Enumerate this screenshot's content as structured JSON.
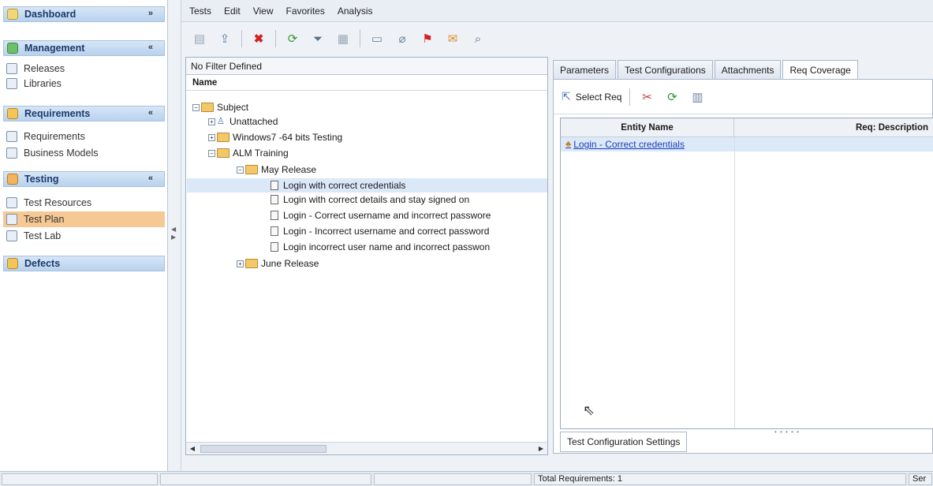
{
  "sidebar": {
    "dashboard": {
      "label": "Dashboard",
      "chevron": "»"
    },
    "management": {
      "label": "Management",
      "chevron": "«"
    },
    "management_items": [
      {
        "label": "Releases"
      },
      {
        "label": "Libraries"
      }
    ],
    "requirements": {
      "label": "Requirements",
      "chevron": "«"
    },
    "requirements_items": [
      {
        "label": "Requirements"
      },
      {
        "label": "Business Models"
      }
    ],
    "testing": {
      "label": "Testing",
      "chevron": "«"
    },
    "testing_items": [
      {
        "label": "Test Resources"
      },
      {
        "label": "Test Plan",
        "active": true
      },
      {
        "label": "Test Lab"
      }
    ],
    "defects": {
      "label": "Defects"
    }
  },
  "menu": [
    "Tests",
    "Edit",
    "View",
    "Favorites",
    "Analysis"
  ],
  "tree": {
    "filter_text": "No Filter Defined",
    "header": "Name",
    "nodes": [
      {
        "label": "Subject"
      },
      {
        "label": "Unattached"
      },
      {
        "label": "Windows7 -64 bits Testing"
      },
      {
        "label": "ALM Training"
      },
      {
        "label": "May Release"
      },
      {
        "label": "Login with correct credentials"
      },
      {
        "label": "Login with correct details and stay signed on"
      },
      {
        "label": "Login - Correct username and incorrect passwore"
      },
      {
        "label": "Login - Incorrect username and correct password"
      },
      {
        "label": "Login incorrect user name and incorrect passwon"
      },
      {
        "label": "June Release"
      }
    ]
  },
  "tabs": [
    "Parameters",
    "Test Configurations",
    "Attachments",
    "Req Coverage"
  ],
  "req_coverage": {
    "select_req_label": "Select Req",
    "columns": [
      "Entity Name",
      "Req: Description"
    ],
    "rows": [
      {
        "entity_name": "Login - Correct credentials"
      }
    ],
    "config_tab_label": "Test Configuration Settings"
  },
  "status": {
    "total_requirements": "Total Requirements: 1",
    "right_cell": "Ser"
  }
}
